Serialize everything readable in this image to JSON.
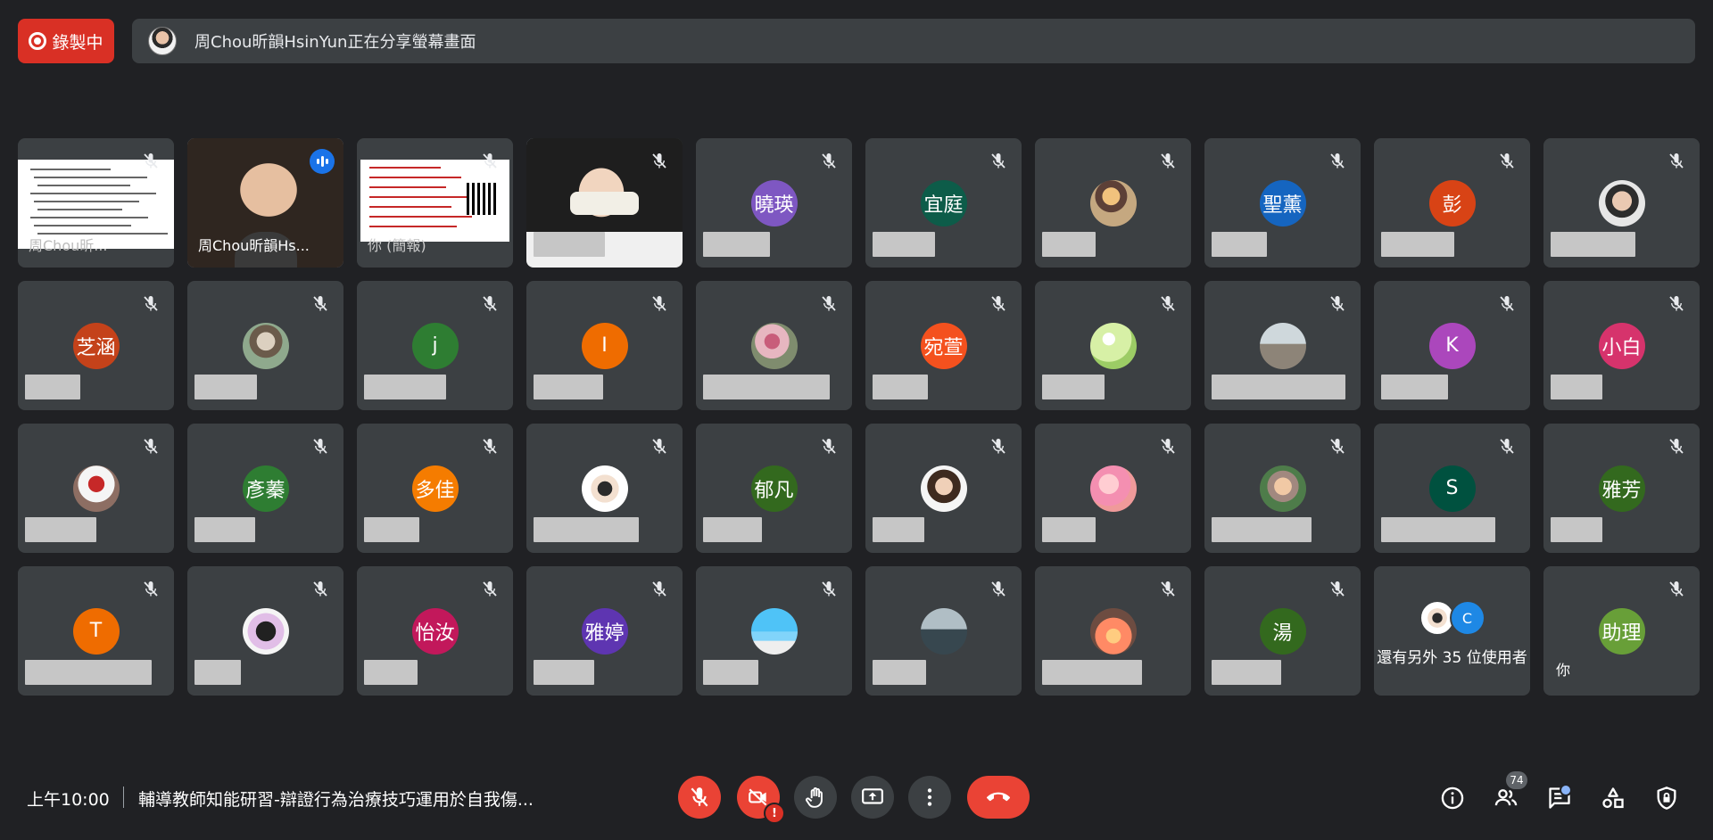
{
  "recording": {
    "label": "錄製中"
  },
  "share_banner": {
    "text": "周Chou昕韻HsinYun正在分享螢幕畫面"
  },
  "tiles": {
    "t0": {
      "name": "周Chou昕..."
    },
    "t1": {
      "name": "周Chou昕韻Hs..."
    },
    "t2": {
      "name": "你 (簡報)"
    },
    "t4": {
      "initials": "曉瑛"
    },
    "t5": {
      "initials": "宜庭"
    },
    "t7": {
      "initials": "聖薰"
    },
    "t8": {
      "initials": "彭"
    },
    "t10": {
      "initials": "芝涵"
    },
    "t12": {
      "initials": "j"
    },
    "t13": {
      "initials": "I"
    },
    "t15": {
      "initials": "宛萱"
    },
    "t18": {
      "initials": "K"
    },
    "t19": {
      "initials": "小白"
    },
    "t21": {
      "initials": "彥蓁"
    },
    "t22": {
      "initials": "多佳"
    },
    "t24": {
      "initials": "郁凡"
    },
    "t28": {
      "initials": "S"
    },
    "t29": {
      "initials": "雅芳"
    },
    "t30": {
      "initials": "T"
    },
    "t32": {
      "initials": "怡汝"
    },
    "t33": {
      "initials": "雅婷"
    },
    "t37": {
      "initials": "湯"
    },
    "t38": {
      "others_text": "還有另外 35 位使用者",
      "badge": "C"
    },
    "t39": {
      "initials": "助理",
      "you": "你"
    }
  },
  "colors": {
    "t4": "#7e57c2",
    "t5": "#0d5c49",
    "t7": "#1565c0",
    "t8": "#d84315",
    "t10": "#c4421a",
    "t12": "#2e7d32",
    "t13": "#ef6c00",
    "t15": "#f4511e",
    "t18": "#ab47bc",
    "t19": "#d6336c",
    "t21": "#2e7d32",
    "t22": "#f57c00",
    "t24": "#33691e",
    "t28": "#00513f",
    "t29": "#33691e",
    "t30": "#ef6c00",
    "t32": "#c2185b",
    "t33": "#5e35b1",
    "t37": "#33691e",
    "t39": "#689f38"
  },
  "bottom": {
    "time": "上午10:00",
    "title": "輔導教師知能研習-辯證行為治療技巧運用於自我傷...",
    "participants_count": "74"
  },
  "icons": {
    "mic": "mic-off-icon",
    "cam": "camera-off-icon",
    "hand": "raise-hand-icon",
    "present": "present-screen-icon",
    "more": "more-vert-icon",
    "leave": "call-end-icon",
    "info": "info-icon",
    "people": "people-icon",
    "chat": "chat-icon",
    "activities": "activities-icon",
    "host": "host-controls-icon"
  }
}
